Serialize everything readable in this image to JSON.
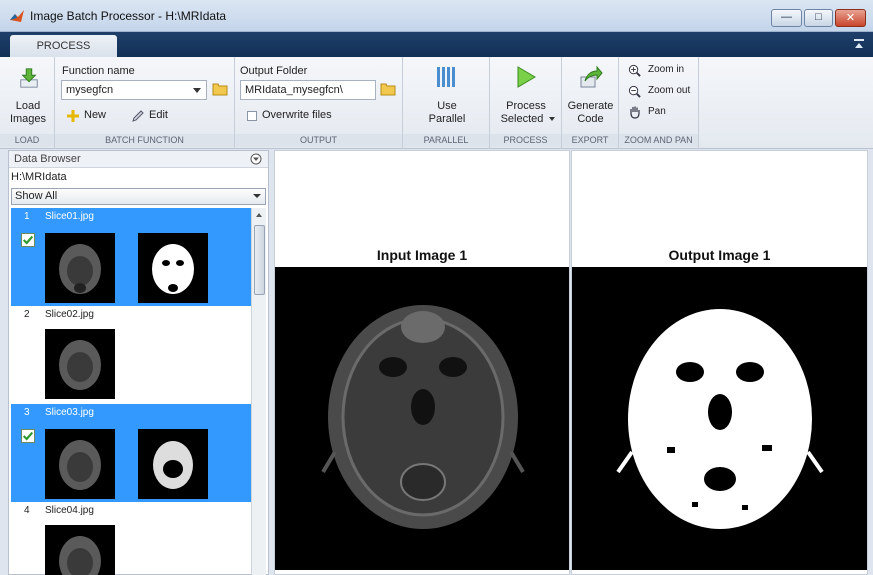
{
  "window": {
    "title": "Image Batch Processor - H:\\MRIdata",
    "minimize": "—",
    "maximize": "□",
    "close": "✕"
  },
  "tabs": [
    {
      "label": "PROCESS",
      "active": true
    }
  ],
  "toolstrip": {
    "load": {
      "button": "Load\nImages",
      "label1": "Load",
      "label2": "Images",
      "section": "LOAD"
    },
    "batch_function": {
      "function_name_label": "Function name",
      "function_name_value": "mysegfcn",
      "new_label": "New",
      "edit_label": "Edit",
      "section": "BATCH FUNCTION"
    },
    "output": {
      "folder_label": "Output Folder",
      "folder_value": "MRIdata_mysegfcn\\",
      "overwrite_label": "Overwrite files",
      "overwrite_checked": false,
      "section": "OUTPUT"
    },
    "parallel": {
      "label1": "Use",
      "label2": "Parallel",
      "section": "PARALLEL"
    },
    "process": {
      "label1": "Process",
      "label2": "Selected",
      "section": "PROCESS"
    },
    "export": {
      "label1": "Generate",
      "label2": "Code",
      "section": "EXPORT"
    },
    "zoom": {
      "zoom_in": "Zoom in",
      "zoom_out": "Zoom out",
      "pan": "Pan",
      "section": "ZOOM AND PAN"
    }
  },
  "data_browser": {
    "title": "Data Browser",
    "path": "H:\\MRIdata",
    "filter": "Show All",
    "items": [
      {
        "index": "1",
        "name": "Slice01.jpg",
        "selected": true,
        "processed": true
      },
      {
        "index": "2",
        "name": "Slice02.jpg",
        "selected": false,
        "processed": false
      },
      {
        "index": "3",
        "name": "Slice03.jpg",
        "selected": true,
        "processed": true
      },
      {
        "index": "4",
        "name": "Slice04.jpg",
        "selected": false,
        "processed": false
      }
    ]
  },
  "input_panel": {
    "title": "Input Image 1"
  },
  "output_panel": {
    "title": "Output Image 1"
  },
  "colors": {
    "selection": "#3399ff",
    "ribbon_dark": "#1a3a64",
    "check_green": "#2f9a2f"
  }
}
